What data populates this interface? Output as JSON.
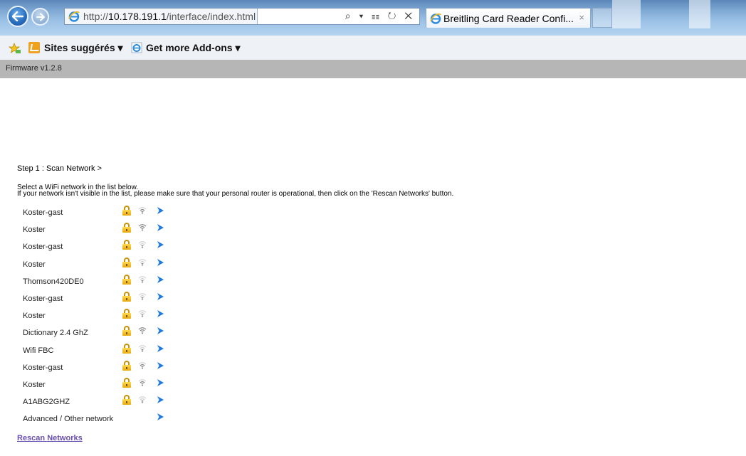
{
  "browser": {
    "url_prefix": "http://",
    "url_host": "10.178.191.1",
    "url_path": "/interface/index.html",
    "address_tools": "⌕ ▾ ☷ ↻ ✕",
    "tab_title": "Breitling Card Reader Confi...",
    "tab_close": "×"
  },
  "favorites": {
    "sites_label": "Sites suggérés ▾",
    "addons_label": "Get more Add-ons ▾"
  },
  "firmware_label": "Firmware v1.2.8",
  "step_title": "Step 1 : Scan Network >",
  "instructions": {
    "line1": "Select a WiFi network in the list below.",
    "line2": "If your network isn't visible in the list, please make sure that your personal router is operational, then click on the 'Rescan Networks' button."
  },
  "networks": [
    {
      "name": "Koster-gast",
      "secured": true,
      "signal": 2
    },
    {
      "name": "Koster",
      "secured": true,
      "signal": 3
    },
    {
      "name": "Koster-gast",
      "secured": true,
      "signal": 1
    },
    {
      "name": "Koster",
      "secured": true,
      "signal": 1
    },
    {
      "name": "Thomson420DE0",
      "secured": true,
      "signal": 1
    },
    {
      "name": "Koster-gast",
      "secured": true,
      "signal": 1
    },
    {
      "name": "Koster",
      "secured": true,
      "signal": 1
    },
    {
      "name": "Dictionary 2.4 GhZ",
      "secured": true,
      "signal": 3
    },
    {
      "name": "Wifi FBC",
      "secured": true,
      "signal": 1
    },
    {
      "name": "Koster-gast",
      "secured": true,
      "signal": 2
    },
    {
      "name": "Koster",
      "secured": true,
      "signal": 2
    },
    {
      "name": "A1ABG2GHZ",
      "secured": true,
      "signal": 1
    },
    {
      "name": "Advanced / Other network",
      "secured": false,
      "signal": 0
    }
  ],
  "rescan_label": "Rescan Networks",
  "colors": {
    "firmware_bar": "#b6b6b6",
    "link": "#6a4fb3",
    "arrow": "#1f7be0",
    "lock": "#f2c12e"
  },
  "icons": {
    "back": "back-arrow-icon",
    "forward": "forward-arrow-icon",
    "lock": "lock-icon",
    "wifi": "wifi-icon",
    "arrow": "chevron-right-icon"
  }
}
